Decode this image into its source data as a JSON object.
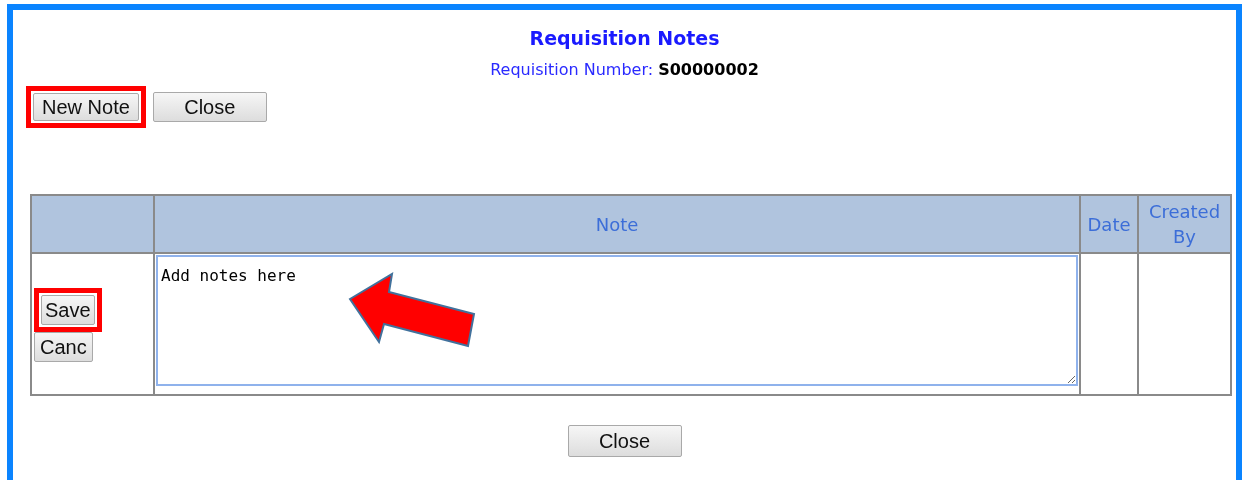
{
  "title": "Requisition Notes",
  "requisition": {
    "label": "Requisition Number:",
    "value": "S00000002"
  },
  "top_buttons": [
    {
      "label": "New Note",
      "highlighted": true
    },
    {
      "label": "Close",
      "highlighted": false
    }
  ],
  "table": {
    "columns": [
      "",
      "Note",
      "Date",
      "Created By"
    ],
    "row": {
      "buttons": [
        {
          "label": "Save",
          "highlighted": true
        },
        {
          "label": "Canc",
          "highlighted": false
        }
      ],
      "note": {
        "value": "Add notes here",
        "pointed_at": true
      }
    }
  },
  "bottom_button": {
    "label": "Close"
  }
}
